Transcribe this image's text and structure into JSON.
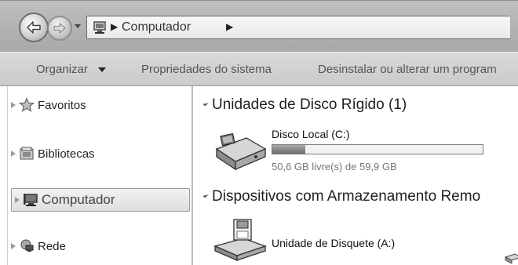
{
  "window": {
    "address_path": "Computador"
  },
  "toolbar": {
    "organize_label": "Organizar",
    "system_properties_label": "Propriedades do sistema",
    "uninstall_label": "Desinstalar ou alterar um program"
  },
  "sidebar": {
    "items": [
      {
        "label": "Favoritos",
        "icon": "star-icon"
      },
      {
        "label": "Bibliotecas",
        "icon": "libraries-icon"
      },
      {
        "label": "Computador",
        "icon": "computer-icon",
        "selected": true
      },
      {
        "label": "Rede",
        "icon": "network-icon"
      }
    ]
  },
  "main": {
    "groups": [
      {
        "title": "Unidades de Disco Rígido (1)",
        "items": [
          {
            "name": "Disco Local (C:)",
            "space_text": "50,6 GB livre(s) de 59,9 GB",
            "used_fraction": 0.155,
            "icon": "hard-disk-icon"
          }
        ]
      },
      {
        "title": "Dispositivos com Armazenamento Remo",
        "items": [
          {
            "name": "Unidade de Disquete (A:)",
            "icon": "floppy-drive-icon"
          }
        ]
      }
    ]
  }
}
